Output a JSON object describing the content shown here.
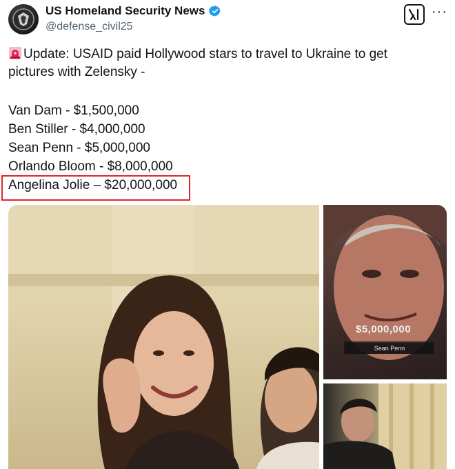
{
  "account": {
    "name": "US Homeland Security News",
    "handle": "@defense_civil25",
    "avatar_icon": "shield-emblem-icon",
    "verified": true
  },
  "tweet": {
    "intro_line1": "Update: USAID paid Hollywood stars to travel to Ukraine to get",
    "intro_line2": "pictures with Zelensky -",
    "items": [
      {
        "text": "Van Dam - $1,500,000"
      },
      {
        "text": "Ben Stiller - $4,000,000"
      },
      {
        "text": "Sean Penn - $5,000,000"
      },
      {
        "text": "Orlando Bloom - $8,000,000"
      },
      {
        "text": "Angelina Jolie – $20,000,000"
      }
    ]
  },
  "media": {
    "top_right_overlay_amount": "$5,000,000",
    "top_right_overlay_name": "Sean Penn"
  },
  "colors": {
    "verified_blue": "#1d9bf0",
    "highlight_red": "#e0262a",
    "alarm_red": "#e0245e"
  }
}
